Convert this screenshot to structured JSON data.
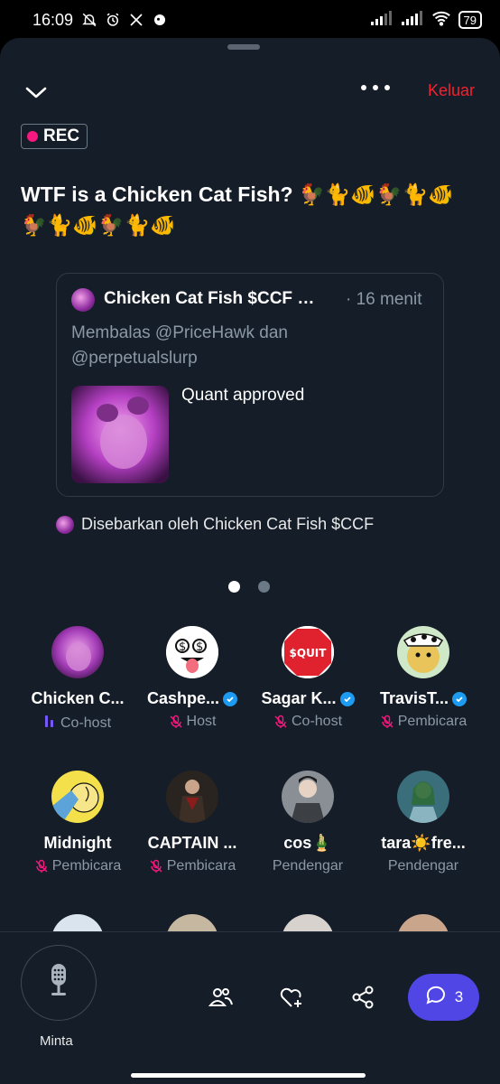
{
  "status_bar": {
    "time": "16:09",
    "battery": "79",
    "icons": [
      "mute-bell-icon",
      "alarm-icon",
      "x-logo-icon",
      "notification-icon",
      "signal-icon",
      "signal-icon",
      "wifi-icon",
      "battery-icon"
    ]
  },
  "header": {
    "leave_label": "Keluar",
    "rec_label": "REC"
  },
  "space": {
    "title": "WTF is a Chicken Cat Fish? 🐓🐈🐠🐓🐈🐠🐓🐈🐠🐓🐈🐠"
  },
  "pinned_post": {
    "author": "Chicken Cat Fish $CCF …",
    "time": "· 16 menit",
    "reply_to": "Membalas @PriceHawk dan @perpetualslurp",
    "text": "Quant approved"
  },
  "spread_by": "Disebarkan oleh Chicken Cat Fish $CCF",
  "pagination": {
    "pages": 2,
    "current": 1
  },
  "participants": [
    {
      "name": "Chicken C...",
      "role": "Co-host",
      "verified": false,
      "role_icon": "speaking-bars-icon"
    },
    {
      "name": "Cashpe...",
      "role": "Host",
      "verified": true,
      "role_icon": "mic-off-icon"
    },
    {
      "name": "Sagar K...",
      "role": "Co-host",
      "verified": true,
      "role_icon": "mic-off-icon"
    },
    {
      "name": "TravisT...",
      "role": "Pembicara",
      "verified": true,
      "role_icon": "mic-off-icon"
    },
    {
      "name": "Midnight",
      "role": "Pembicara",
      "verified": false,
      "role_icon": "mic-off-icon"
    },
    {
      "name": "CAPTAIN ...",
      "role": "Pembicara",
      "verified": false,
      "role_icon": "mic-off-icon"
    },
    {
      "name": "cos🎍",
      "role": "Pendengar",
      "verified": false,
      "role_icon": ""
    },
    {
      "name": "tara☀️fre...",
      "role": "Pendengar",
      "verified": false,
      "role_icon": ""
    }
  ],
  "avatar_overlays": {
    "sagar": "$QUIT"
  },
  "bottom_bar": {
    "request_label": "Minta",
    "comment_count": "3"
  },
  "colors": {
    "sheet_bg": "#151d28",
    "leave": "#f4212e",
    "rec_dot": "#f91880",
    "verified": "#1d9bf0",
    "accent_button": "#4f46e5",
    "muted_text": "#8b98a5",
    "speaking": "#7856ff"
  }
}
